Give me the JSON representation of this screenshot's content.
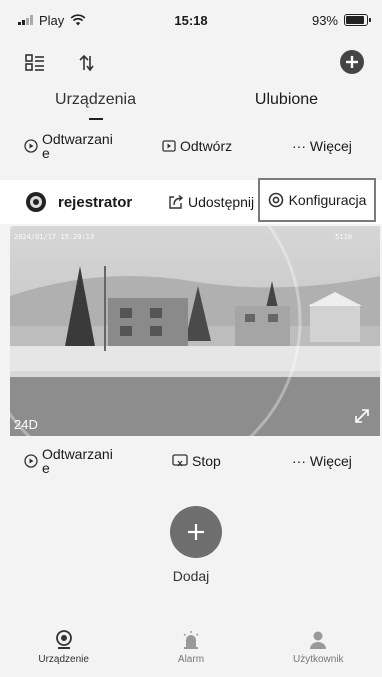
{
  "status_bar": {
    "carrier": "Play",
    "time": "15:18",
    "battery_percent": "93%",
    "battery_level": 0.93
  },
  "tabs": {
    "devices": "Urządzenia",
    "favorites": "Ulubione"
  },
  "top_actions": {
    "playback": "Odtwarzani\ne",
    "play": "Odtwórz",
    "more": "··· Więcej"
  },
  "camera": {
    "name": "rejestrator",
    "share_label": "Udostępnij",
    "config_label": "Konfiguracja",
    "timestamp": "2024/01/17 15:20:13",
    "overlay_code": "5110",
    "fps_label": "24D"
  },
  "bottom_actions": {
    "playback": "Odtwarzani\ne",
    "stop": "Stop",
    "more": "··· Więcej"
  },
  "add": {
    "label": "Dodaj"
  },
  "nav": {
    "device": "Urządzenie",
    "alarm": "Alarm",
    "user": "Użytkownik"
  }
}
